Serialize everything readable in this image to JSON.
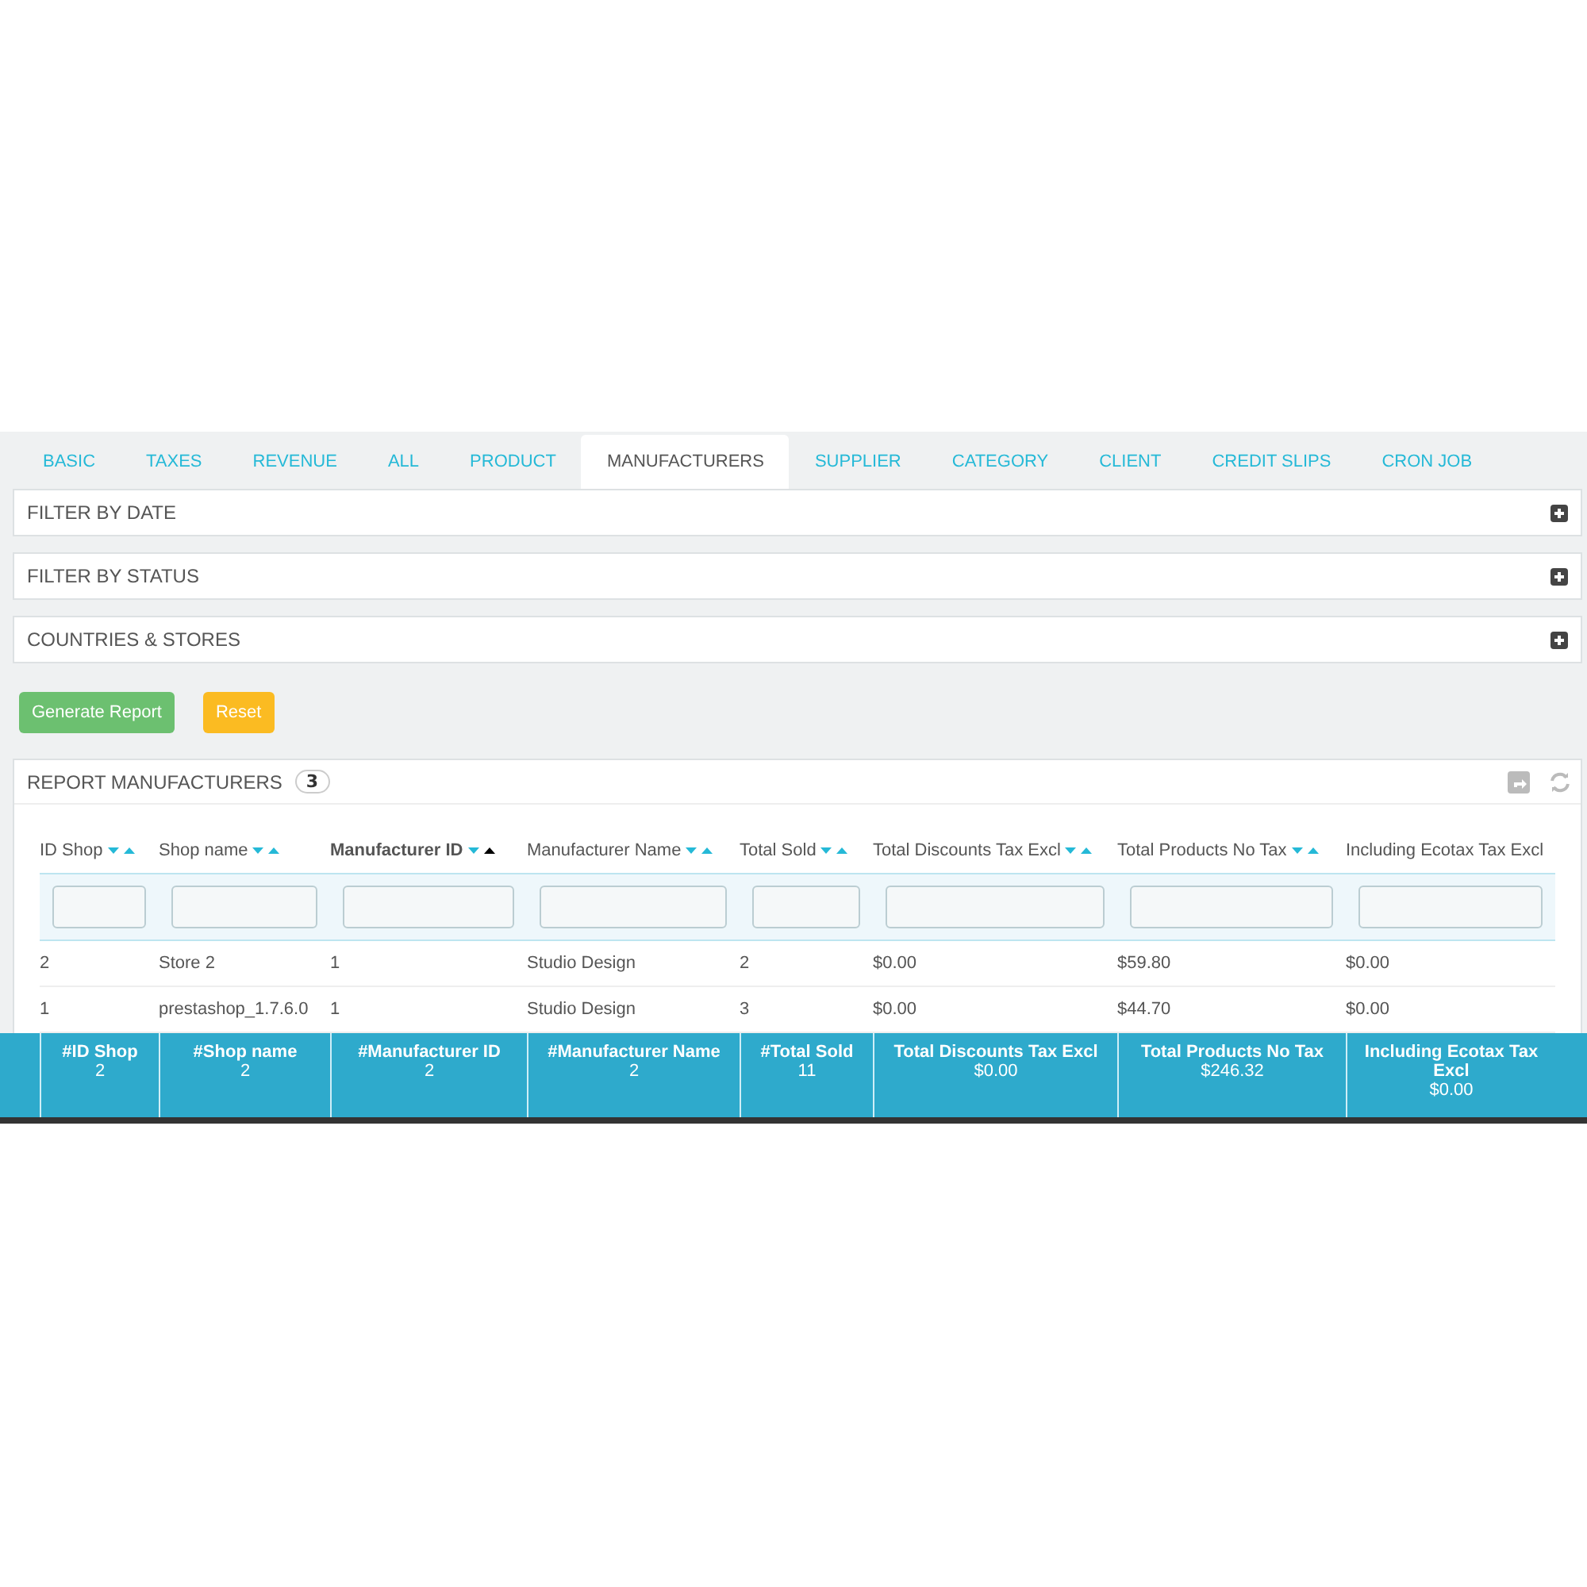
{
  "tabs": [
    {
      "label": "BASIC",
      "selected": false
    },
    {
      "label": "TAXES",
      "selected": false
    },
    {
      "label": "REVENUE",
      "selected": false
    },
    {
      "label": "ALL",
      "selected": false
    },
    {
      "label": "PRODUCT",
      "selected": false
    },
    {
      "label": "MANUFACTURERS",
      "selected": true
    },
    {
      "label": "SUPPLIER",
      "selected": false
    },
    {
      "label": "CATEGORY",
      "selected": false
    },
    {
      "label": "CLIENT",
      "selected": false
    },
    {
      "label": "CREDIT SLIPS",
      "selected": false
    },
    {
      "label": "CRON JOB",
      "selected": false
    }
  ],
  "filter_panels": [
    {
      "title": "FILTER BY DATE"
    },
    {
      "title": "FILTER BY STATUS"
    },
    {
      "title": "COUNTRIES & STORES"
    }
  ],
  "buttons": [
    {
      "label": "Generate Report",
      "kind": "success"
    },
    {
      "label": "Reset",
      "kind": "warning"
    }
  ],
  "report": {
    "title": "REPORT MANUFACTURERS",
    "count": "3",
    "columns": [
      {
        "label": "ID Shop",
        "arrows": true,
        "sorted": false
      },
      {
        "label": "Shop name",
        "arrows": true,
        "sorted": false
      },
      {
        "label": "Manufacturer ID",
        "arrows": true,
        "sorted": true
      },
      {
        "label": "Manufacturer Name",
        "arrows": true,
        "sorted": false
      },
      {
        "label": "Total Sold",
        "arrows": true,
        "sorted": false
      },
      {
        "label": "Total Discounts Tax Excl",
        "arrows": true,
        "sorted": false
      },
      {
        "label": "Total Products No Tax",
        "arrows": true,
        "sorted": false
      },
      {
        "label": "Including Ecotax Tax Excl",
        "arrows": false,
        "sorted": false
      }
    ],
    "rows": [
      [
        "2",
        "Store 2",
        "1",
        "Studio Design",
        "2",
        "$0.00",
        "$59.80",
        "$0.00"
      ],
      [
        "1",
        "prestashop_1.7.6.0",
        "1",
        "Studio Design",
        "3",
        "$0.00",
        "$44.70",
        "$0.00"
      ]
    ],
    "totals": [
      {
        "label": "#ID Shop",
        "value": "2"
      },
      {
        "label": "#Shop name",
        "value": "2"
      },
      {
        "label": "#Manufacturer ID",
        "value": "2"
      },
      {
        "label": "#Manufacturer Name",
        "value": "2"
      },
      {
        "label": "#Total Sold",
        "value": "11"
      },
      {
        "label": "Total Discounts Tax Excl",
        "value": "$0.00"
      },
      {
        "label": "Total Products No Tax",
        "value": "$246.32"
      },
      {
        "label": "Including Ecotax Tax Excl",
        "value": "$0.00"
      }
    ]
  }
}
